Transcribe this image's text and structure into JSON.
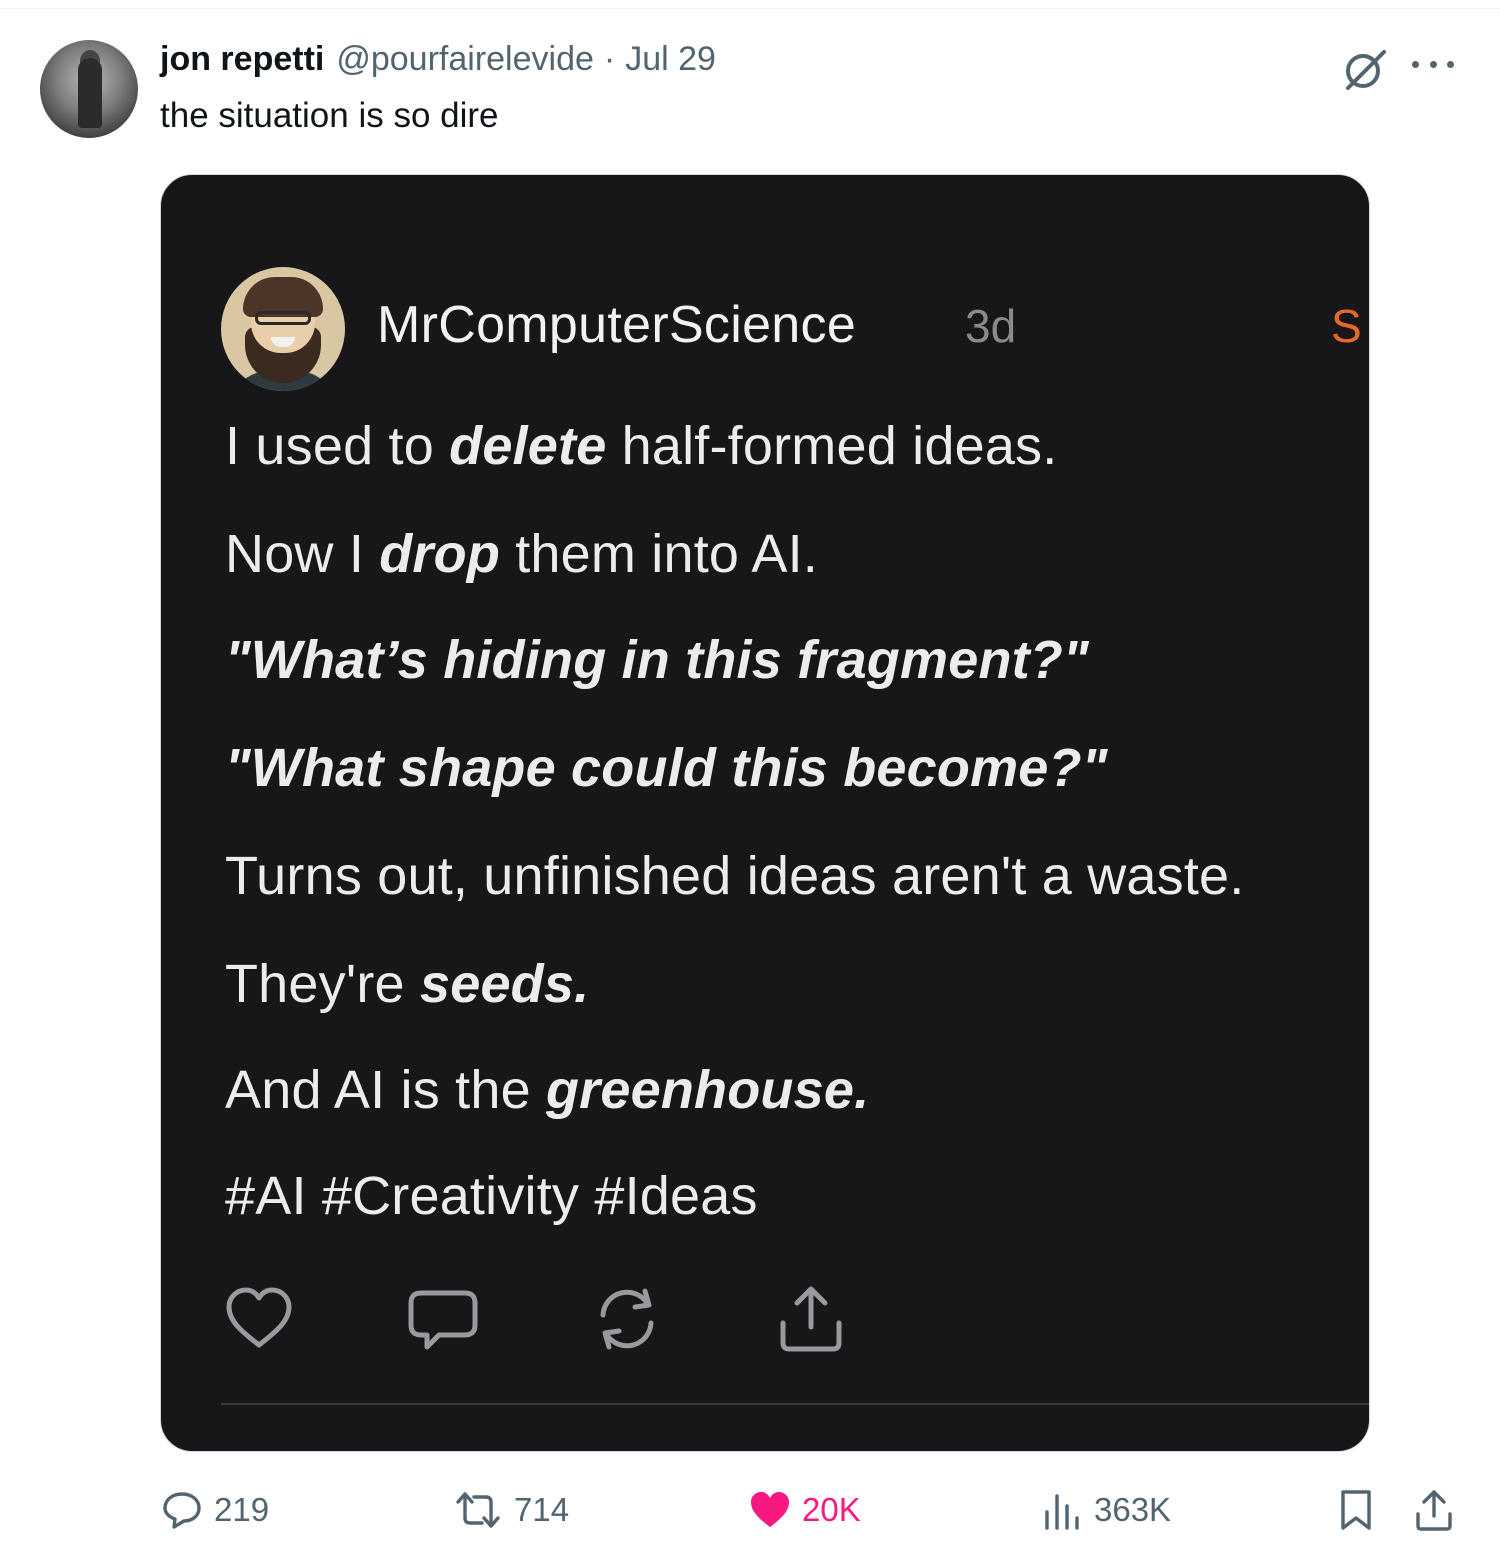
{
  "tweet": {
    "author_name": "jon repetti",
    "author_handle": "@pourfairelevide",
    "separator": "·",
    "date": "Jul 29",
    "text": "the situation is so dire"
  },
  "embedded_post": {
    "author": "MrComputerScience",
    "time": "3d",
    "subscribe_fragment": "S",
    "lines": [
      {
        "pre": "I used to ",
        "em": "delete",
        "post": " half-formed ideas."
      },
      {
        "pre": "Now I ",
        "em": "drop",
        "post": " them into AI."
      },
      {
        "quote": "\"What’s hiding in this fragment?\""
      },
      {
        "quote": "\"What shape could this become?\""
      },
      {
        "plain": "Turns out, unfinished ideas aren't a waste."
      },
      {
        "pre": "They're ",
        "em": "seeds.",
        "post": ""
      },
      {
        "pre": "And AI is the ",
        "em": "greenhouse.",
        "post": ""
      },
      {
        "plain": "#AI #Creativity #Ideas"
      }
    ]
  },
  "stats": {
    "replies": "219",
    "reposts": "714",
    "likes": "20K",
    "views": "363K"
  },
  "colors": {
    "like_accent": "#f91880",
    "subscribe_accent": "#e8672a",
    "muted": "#536471"
  }
}
